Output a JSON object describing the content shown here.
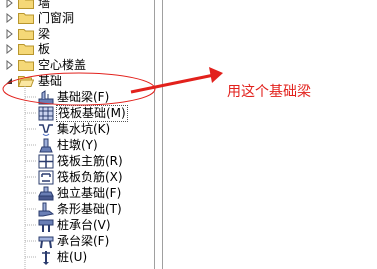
{
  "tree": {
    "folders": [
      {
        "label": "墙"
      },
      {
        "label": "门窗洞"
      },
      {
        "label": "梁"
      },
      {
        "label": "板"
      },
      {
        "label": "空心楼盖"
      },
      {
        "label": "基础"
      }
    ],
    "children": [
      {
        "label": "基础梁(F)",
        "icon": "foundation-beam-icon"
      },
      {
        "label": "筏板基础(M)",
        "icon": "raft-foundation-icon"
      },
      {
        "label": "集水坑(K)",
        "icon": "sump-pit-icon"
      },
      {
        "label": "柱墩(Y)",
        "icon": "column-pier-icon"
      },
      {
        "label": "筏板主筋(R)",
        "icon": "raft-main-rebar-icon"
      },
      {
        "label": "筏板负筋(X)",
        "icon": "raft-negative-rebar-icon"
      },
      {
        "label": "独立基础(F)",
        "icon": "isolated-footing-icon"
      },
      {
        "label": "条形基础(T)",
        "icon": "strip-footing-icon"
      },
      {
        "label": "桩承台(V)",
        "icon": "pile-cap-icon"
      },
      {
        "label": "承台梁(F)",
        "icon": "cap-beam-icon"
      },
      {
        "label": "桩(U)",
        "icon": "pile-icon"
      }
    ]
  },
  "annotation": {
    "text": "用这个基础梁",
    "color": "#e2211c"
  }
}
